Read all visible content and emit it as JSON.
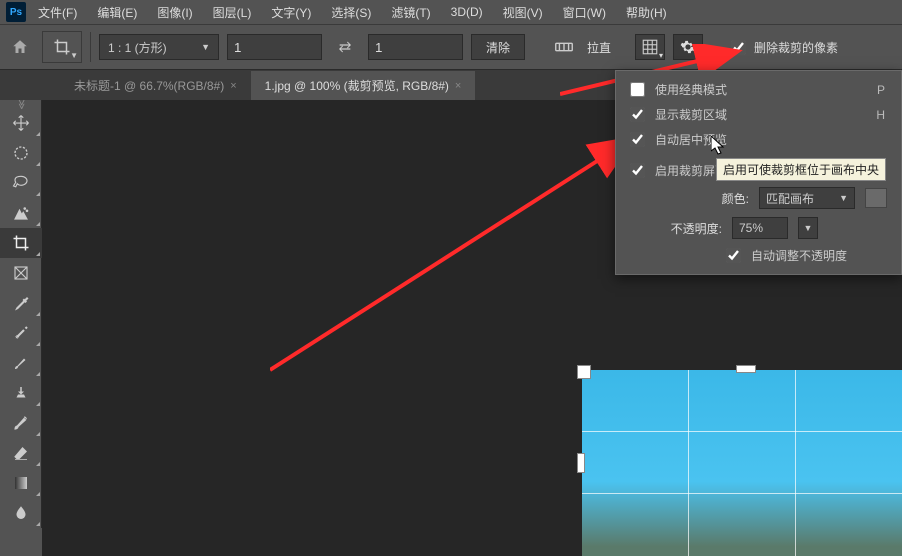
{
  "app": {
    "logo": "Ps"
  },
  "menu": {
    "file": "文件(F)",
    "edit": "编辑(E)",
    "image": "图像(I)",
    "layer": "图层(L)",
    "type": "文字(Y)",
    "select": "选择(S)",
    "filter": "滤镜(T)",
    "threeD": "3D(D)",
    "view": "视图(V)",
    "window": "窗口(W)",
    "help": "帮助(H)"
  },
  "options": {
    "ratio_label": "1 : 1 (方形)",
    "width_value": "1",
    "height_value": "1",
    "clear": "清除",
    "straighten": "拉直",
    "delete_cropped": "删除裁剪的像素"
  },
  "tabs": {
    "tab1": "未标题-1 @ 66.7%(RGB/8#)",
    "tab2": "1.jpg @ 100% (裁剪预览, RGB/8#)"
  },
  "popup": {
    "classic_mode": "使用经典模式",
    "classic_key": "P",
    "show_crop": "显示裁剪区域",
    "show_key": "H",
    "auto_center": "自动居中预览",
    "enable_shield": "启用裁剪屏蔽",
    "color_label": "颜色:",
    "color_value": "匹配画布",
    "opacity_label": "不透明度:",
    "opacity_value": "75%",
    "auto_opacity": "自动调整不透明度"
  },
  "tooltip": "启用可使裁剪框位于画布中央",
  "chart_data": null
}
